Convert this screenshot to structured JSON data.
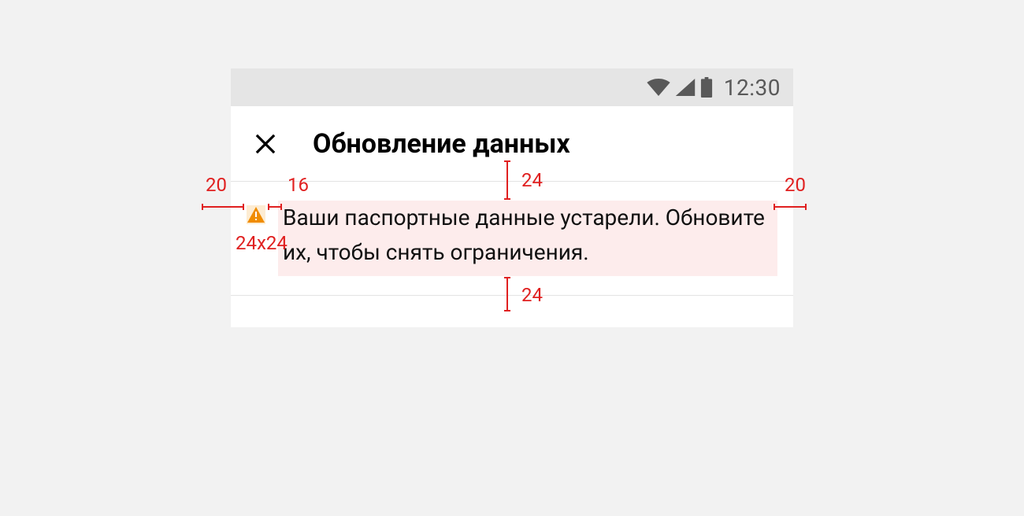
{
  "status_bar": {
    "time": "12:30"
  },
  "app_bar": {
    "title": "Обновление данных"
  },
  "notice": {
    "message": "Ваши паспортные данные устарели. Обновите их, чтобы снять ограничения."
  },
  "spec": {
    "padding_top": "24",
    "padding_bottom": "24",
    "padding_left": "20",
    "padding_right": "20",
    "icon_gap": "16",
    "icon_size": "24x24"
  },
  "colors": {
    "redline": "#e02020",
    "warning_icon": "#f08c00",
    "warning_bg": "#fdecd2",
    "highlight_bg": "#fdecec"
  }
}
